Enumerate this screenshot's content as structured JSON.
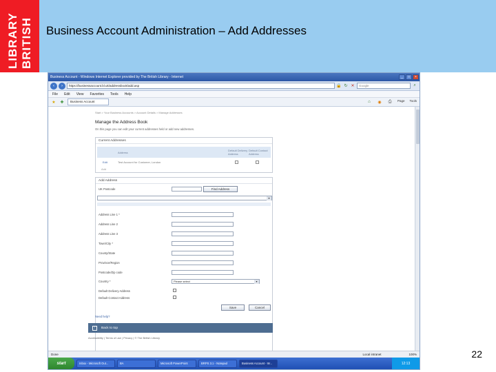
{
  "slide": {
    "logo_line1": "LIBRARY",
    "logo_line2": "BRITISH",
    "title": "Business Account Administration – Add Addresses",
    "page_number": "22",
    "colors": {
      "header_band": "#99ccf0",
      "logo": "#ef1c24"
    }
  },
  "browser": {
    "window_title": "Business Account - Windows Internet Explorer provided by The British Library - Internet",
    "url": "https://businessaccount.bl.uk/addressbook/add.asp",
    "search_placeholder": "Google",
    "menu": [
      "File",
      "Edit",
      "View",
      "Favorites",
      "Tools",
      "Help"
    ],
    "tab_label": "Business Account",
    "toolbar_right": [
      "Page",
      "Tools"
    ]
  },
  "page": {
    "breadcrumb": "Start > Your Business Accounts > Account Details > Manage Addresses",
    "heading": "Manage the Address Book",
    "description": "On this page you can edit your current addresses held or add new addresses.",
    "current_addresses": {
      "panel_title": "Current Addresses",
      "columns": [
        "Address",
        "Default Delivery Address",
        "Default Contact Address"
      ],
      "rows": [
        {
          "action": "Edit",
          "address": "Test Account for Customer, London"
        }
      ],
      "add_link": "Add"
    },
    "add_address": {
      "panel_title": "Add Address",
      "postcode_label": "UK Postcode",
      "find_button": "Find Address",
      "fields": [
        "Address Line 1 *",
        "Address Line 2",
        "Address Line 3",
        "Town/City *",
        "County/State",
        "Province/Region",
        "Postcode/Zip code",
        "Country *"
      ],
      "country_value": "Please select",
      "checkboxes": [
        "Default Delivery Address",
        "Default Contact Address"
      ],
      "save_button": "Save",
      "cancel_button": "Cancel"
    },
    "need_help": "Need help?",
    "back_to_top": "Back to top",
    "footer_links": "Accessibility | Terms of use | Privacy | © The British Library"
  },
  "statusbar": {
    "left": "Done",
    "zone": "Local intranet",
    "zoom": "100%"
  },
  "taskbar": {
    "start": "start",
    "tasks": [
      "Inbox - Microsoft Out...",
      "BA",
      "Microsoft PowerPoint",
      "BRPS 3.1 - Notepad",
      "Business Account - W..."
    ],
    "clock": "12:13"
  }
}
